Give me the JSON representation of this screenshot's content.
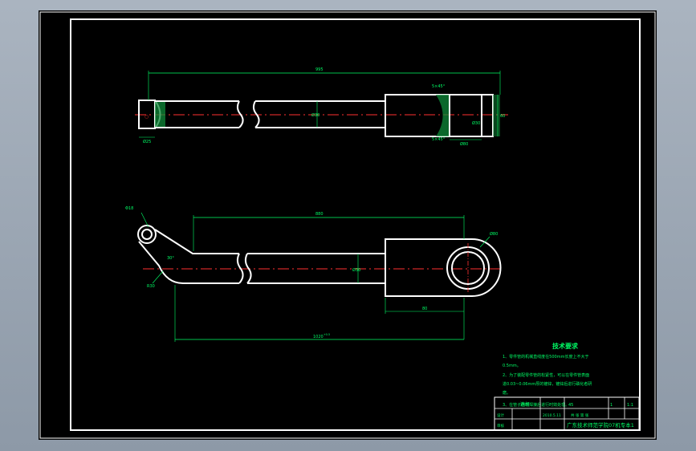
{
  "drawing": {
    "top_view": {
      "dim_total_length": "995",
      "dim_tube_dia": "Ø30",
      "dim_chamfer_top": "5×45°",
      "dim_chamfer_bottom": "5×45°",
      "dim_end_width": "Ø80",
      "dim_left_end": "Ø25",
      "dim_right_end": "Ø30",
      "dim_height": "60"
    },
    "front_view": {
      "dim_hole_small": "Φ18",
      "dim_upper_length": "880",
      "dim_angle": "30°",
      "dim_radius": "R30",
      "dim_tube": "Ø30",
      "dim_hole_large": "Ø80",
      "dim_head_length": "80",
      "dim_overall": "1020",
      "dim_overall_tol": "+0.5"
    },
    "tech": {
      "title": "技术要求",
      "line1": "1、零件管的机械直线度在500mm长度上不大于",
      "line2": "0.5mm。",
      "line3": "2、为了装配零件管的松紧性，可以在零件管表面",
      "line4": "进0.03~0.06mm厚的镀锌，镀锌后进行磷化者研",
      "line5": "磨。",
      "line6": "3、在管子两端焊接后进行时效处理。"
    },
    "title_block": {
      "part_name": "连杆",
      "material": "45",
      "scale": "1:1",
      "school": "广东技术师范学院07机专本1",
      "designer": "设计",
      "checker": "审核",
      "date": "2010.5.11",
      "sheet": "共 张 第 张",
      "qty": "1"
    }
  }
}
